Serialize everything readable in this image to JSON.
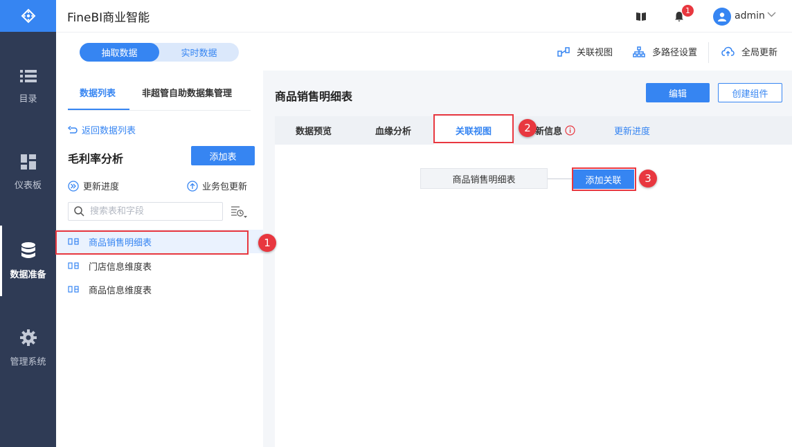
{
  "app": {
    "title": "FineBI商业智能"
  },
  "nav": {
    "items": [
      {
        "label": "目录",
        "icon": "list-icon"
      },
      {
        "label": "仪表板",
        "icon": "dashboard-icon"
      },
      {
        "label": "数据准备",
        "icon": "database-icon",
        "active": true
      },
      {
        "label": "管理系统",
        "icon": "gear-icon"
      }
    ]
  },
  "header": {
    "notification_count": "1",
    "user": "admin"
  },
  "toolbar": {
    "modes": [
      "抽取数据",
      "实时数据"
    ],
    "active_mode": "抽取数据",
    "actions": [
      "关联视图",
      "多路径设置",
      "全局更新"
    ]
  },
  "left_panel": {
    "tabs": [
      "数据列表",
      "非超管自助数据集管理"
    ],
    "back_link": "返回数据列表",
    "package_title": "毛利率分析",
    "add_table_label": "添加表",
    "update_progress": "更新进度",
    "package_update": "业务包更新",
    "search_placeholder": "搜索表和字段",
    "tables": [
      {
        "name": "商品销售明细表",
        "selected": true
      },
      {
        "name": "门店信息维度表",
        "selected": false
      },
      {
        "name": "商品信息维度表",
        "selected": false
      }
    ]
  },
  "right_panel": {
    "title": "商品销售明细表",
    "edit_label": "编辑",
    "create_component_label": "创建组件",
    "tabs": [
      "数据预览",
      "血缘分析",
      "关联视图",
      "新信息",
      "更新进度"
    ],
    "active_tab": "关联视图",
    "node_label": "商品销售明细表",
    "add_relation_label": "添加关联"
  },
  "callouts": [
    "1",
    "2",
    "3"
  ],
  "colors": {
    "primary": "#3685f2",
    "nav_bg": "#2f3b55",
    "callout": "#e8373f"
  }
}
